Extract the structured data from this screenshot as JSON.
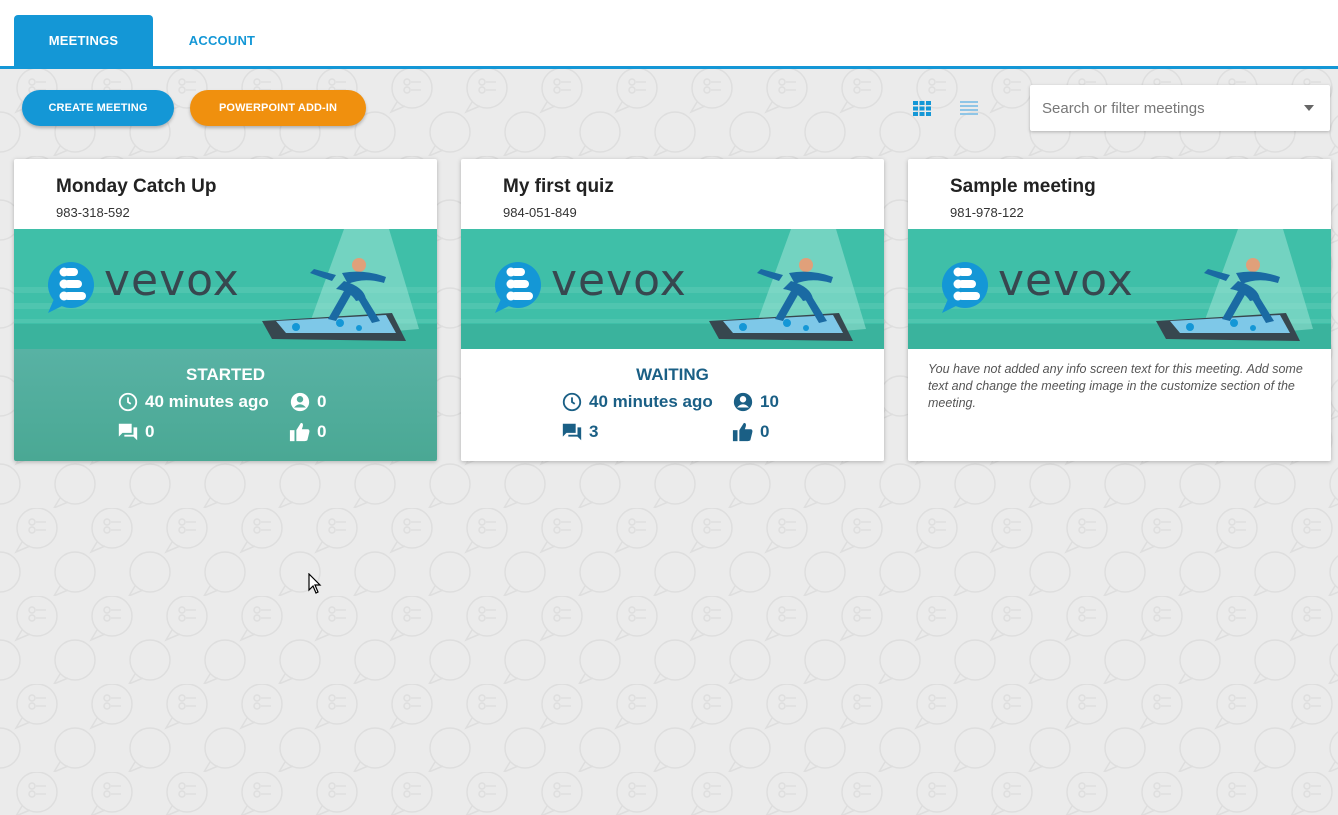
{
  "nav": {
    "tabs": [
      {
        "label": "MEETINGS",
        "active": true
      },
      {
        "label": "ACCOUNT",
        "active": false
      }
    ]
  },
  "toolbar": {
    "create_label": "CREATE MEETING",
    "ppt_label": "POWERPOINT ADD-IN",
    "view_options": [
      "grid-view-icon",
      "list-view-icon"
    ],
    "search_placeholder": "Search or filter meetings"
  },
  "meetings": [
    {
      "title": "Monday Catch Up",
      "code": "983-318-592",
      "brand": "vevox",
      "status": "STARTED",
      "time": "40 minutes ago",
      "participants": "0",
      "messages": "0",
      "likes": "0"
    },
    {
      "title": "My first quiz",
      "code": "984-051-849",
      "brand": "vevox",
      "status": "WAITING",
      "time": "40 minutes ago",
      "participants": "10",
      "messages": "3",
      "likes": "0"
    },
    {
      "title": "Sample meeting",
      "code": "981-978-122",
      "brand": "vevox",
      "info": "You have not added any info screen text for this meeting. Add some text and change the meeting image in the customize section of the meeting."
    }
  ],
  "colors": {
    "primary": "#1497d6",
    "orange": "#f0900e",
    "teal": "#3fbfa8",
    "started_bg": "#52ad9c",
    "waiting_text": "#1a5f85"
  }
}
